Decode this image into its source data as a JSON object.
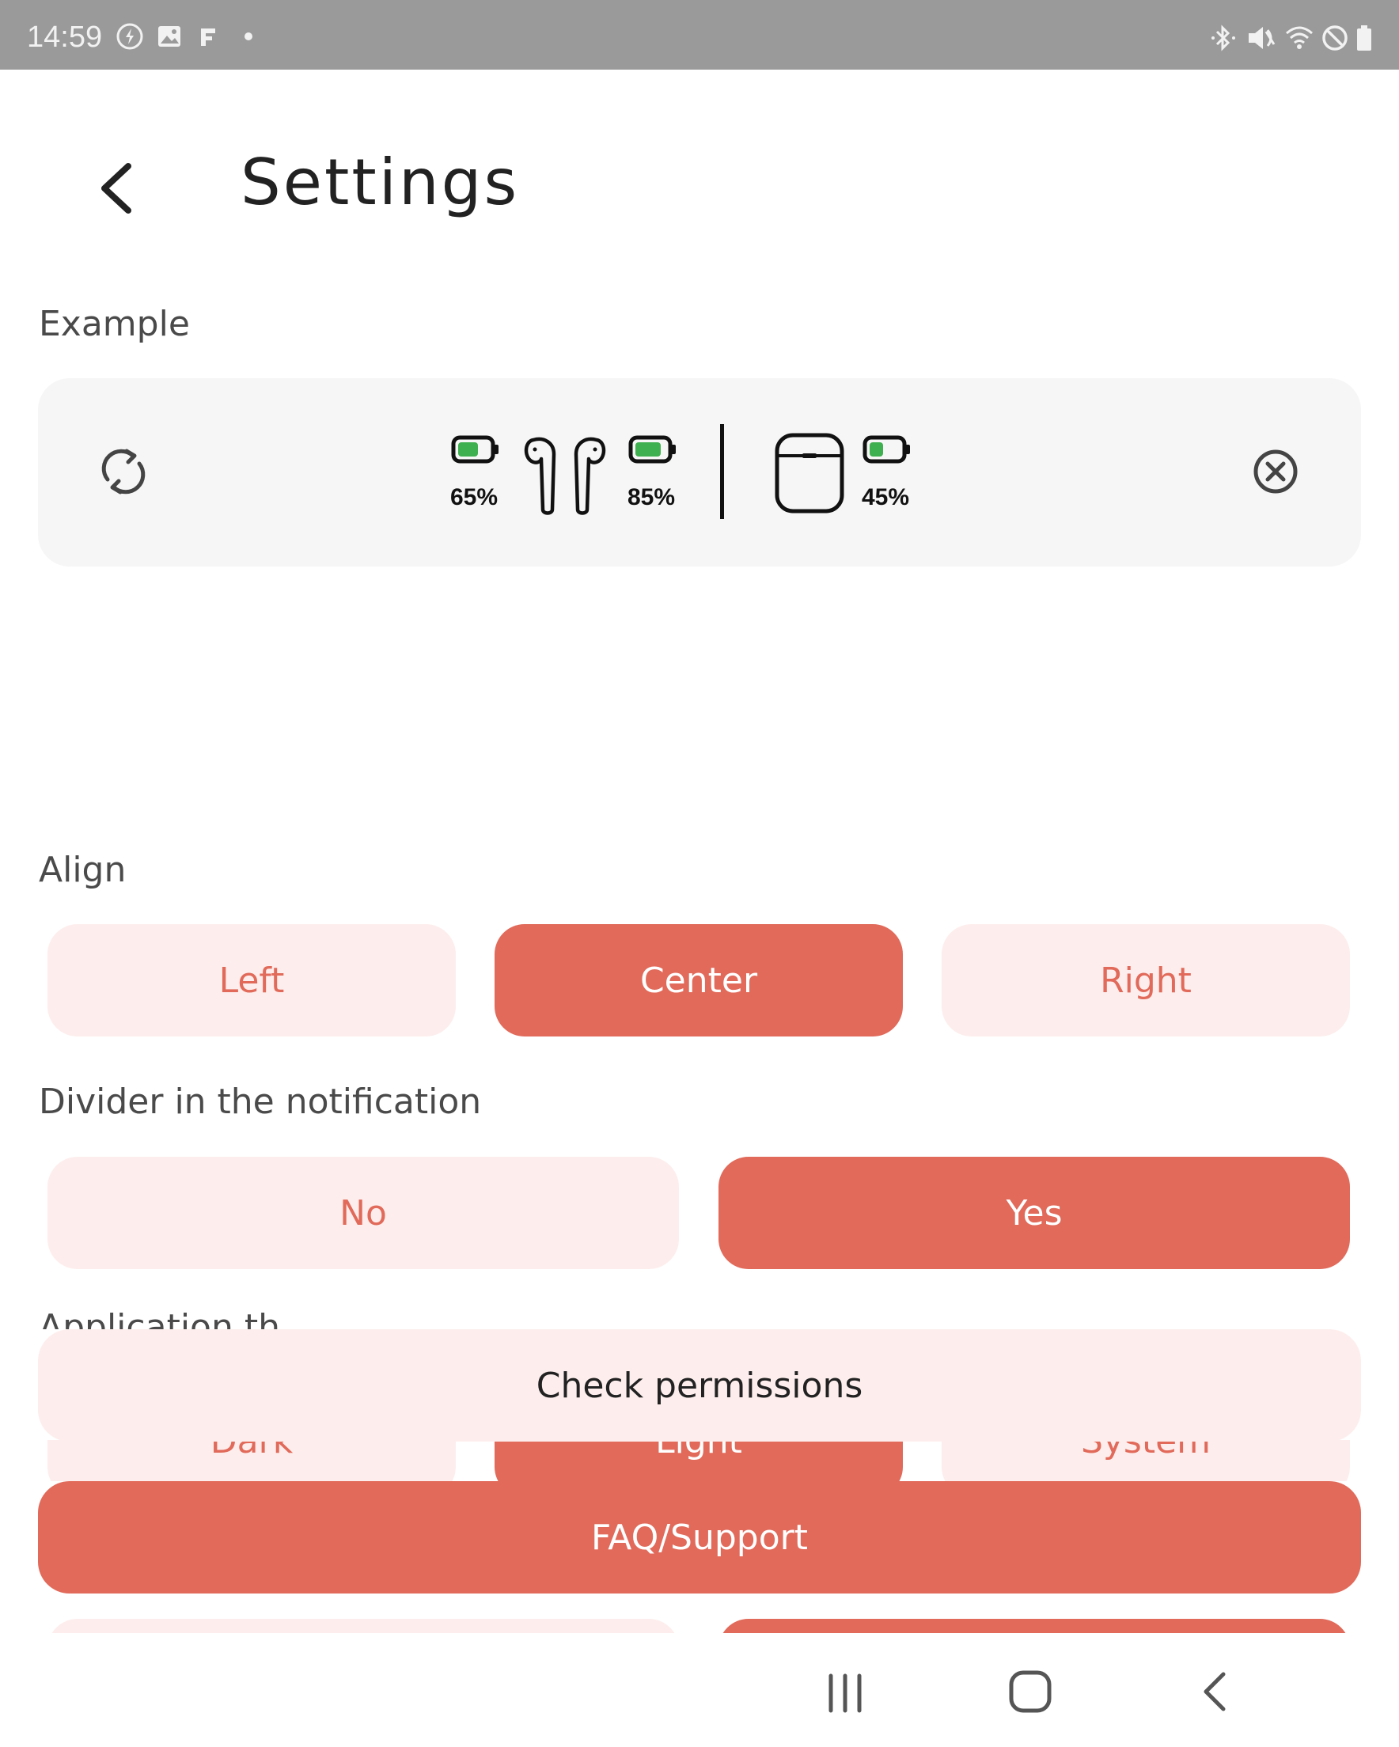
{
  "status_bar": {
    "time": "14:59",
    "left_icons": [
      "data-saver-icon",
      "gallery-icon",
      "flipboard-icon",
      "dot-icon"
    ],
    "right_icons": [
      "bluetooth-icon",
      "mute-icon",
      "wifi-icon",
      "dnd-icon",
      "battery-icon"
    ]
  },
  "header": {
    "back_icon": "chevron-left-icon",
    "title": "Settings"
  },
  "example": {
    "label": "Example",
    "left_earbud_pct": "65%",
    "right_earbud_pct": "85%",
    "case_pct": "45%",
    "left_earbud_level": 0.65,
    "right_earbud_level": 0.85,
    "case_level": 0.45,
    "refresh_icon": "refresh-icon",
    "close_icon": "close-circle-icon",
    "battery_color": "#3fb04f"
  },
  "align": {
    "label": "Align",
    "options": [
      "Left",
      "Center",
      "Right"
    ],
    "selected": "Center"
  },
  "divider": {
    "label": "Divider in the notification",
    "options": [
      "No",
      "Yes"
    ],
    "selected": "Yes"
  },
  "theme": {
    "label_partial": "Application th",
    "options": [
      "Dark",
      "Light",
      "System"
    ],
    "selected": "Light"
  },
  "actions": {
    "check_permissions": "Check permissions",
    "faq_support": "FAQ/Support"
  },
  "colors": {
    "accent": "#e16a5a",
    "accent_light": "#fdeeed",
    "status_bar": "#9a9a9a",
    "card_bg": "#f6f6f6"
  },
  "nav_bar": {
    "recents_icon": "recents-icon",
    "home_icon": "home-icon",
    "back_icon": "back-icon"
  }
}
